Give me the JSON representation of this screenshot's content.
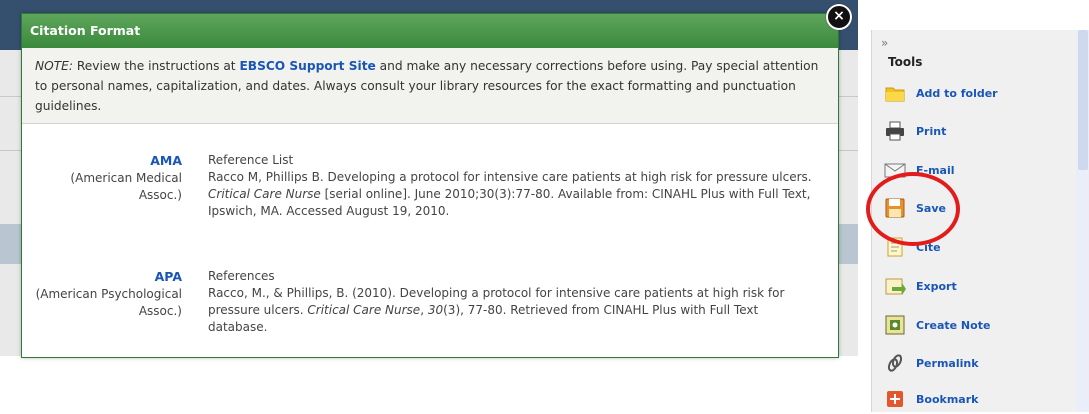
{
  "modal": {
    "title": "Citation Format",
    "note_label": "NOTE:",
    "note_text_1": " Review the instructions at ",
    "note_link": "EBSCO Support Site",
    "note_text_2": " and make any necessary corrections before using. Pay special attention to personal names, capitalization, and dates. Always consult your library resources for the exact formatting and punctuation guidelines.",
    "close_glyph": "×"
  },
  "citations": [
    {
      "abbr": "AMA",
      "style_name": "(American Medical Assoc.)",
      "heading": "Reference List",
      "line_a": "Racco M, Phillips B. Developing a protocol for intensive care patients at high risk for pressure ulcers.",
      "journal": "Critical Care Nurse",
      "line_b": " [serial online]. June 2010;30(3):77-80. Available from: CINAHL Plus with Full Text, Ipswich, MA. Accessed August 19, 2010."
    },
    {
      "abbr": "APA",
      "style_name": "(American Psychological Assoc.)",
      "heading": "References",
      "line_a": "Racco, M., & Phillips, B. (2010). Developing a protocol for intensive care patients at high risk for pressure ulcers. ",
      "journal": "Critical Care Nurse",
      "sep": ", ",
      "volume": "30",
      "line_b": "(3), 77-80. Retrieved from CINAHL Plus with Full Text database."
    }
  ],
  "tools": {
    "chevron": "»",
    "title": "Tools",
    "items": [
      {
        "label": "Add to folder",
        "icon": "folder-icon"
      },
      {
        "label": "Print",
        "icon": "printer-icon"
      },
      {
        "label": "E-mail",
        "icon": "envelope-icon"
      },
      {
        "label": "Save",
        "icon": "floppy-disk-icon"
      },
      {
        "label": "Cite",
        "icon": "cite-icon"
      },
      {
        "label": "Export",
        "icon": "export-icon"
      },
      {
        "label": "Create Note",
        "icon": "note-icon"
      },
      {
        "label": "Permalink",
        "icon": "link-icon"
      },
      {
        "label": "Bookmark",
        "icon": "bookmark-plus-icon"
      }
    ]
  },
  "colors": {
    "modal_header": "#3a8a3c",
    "link": "#1a56b6",
    "highlight_circle": "#e21b1b"
  }
}
